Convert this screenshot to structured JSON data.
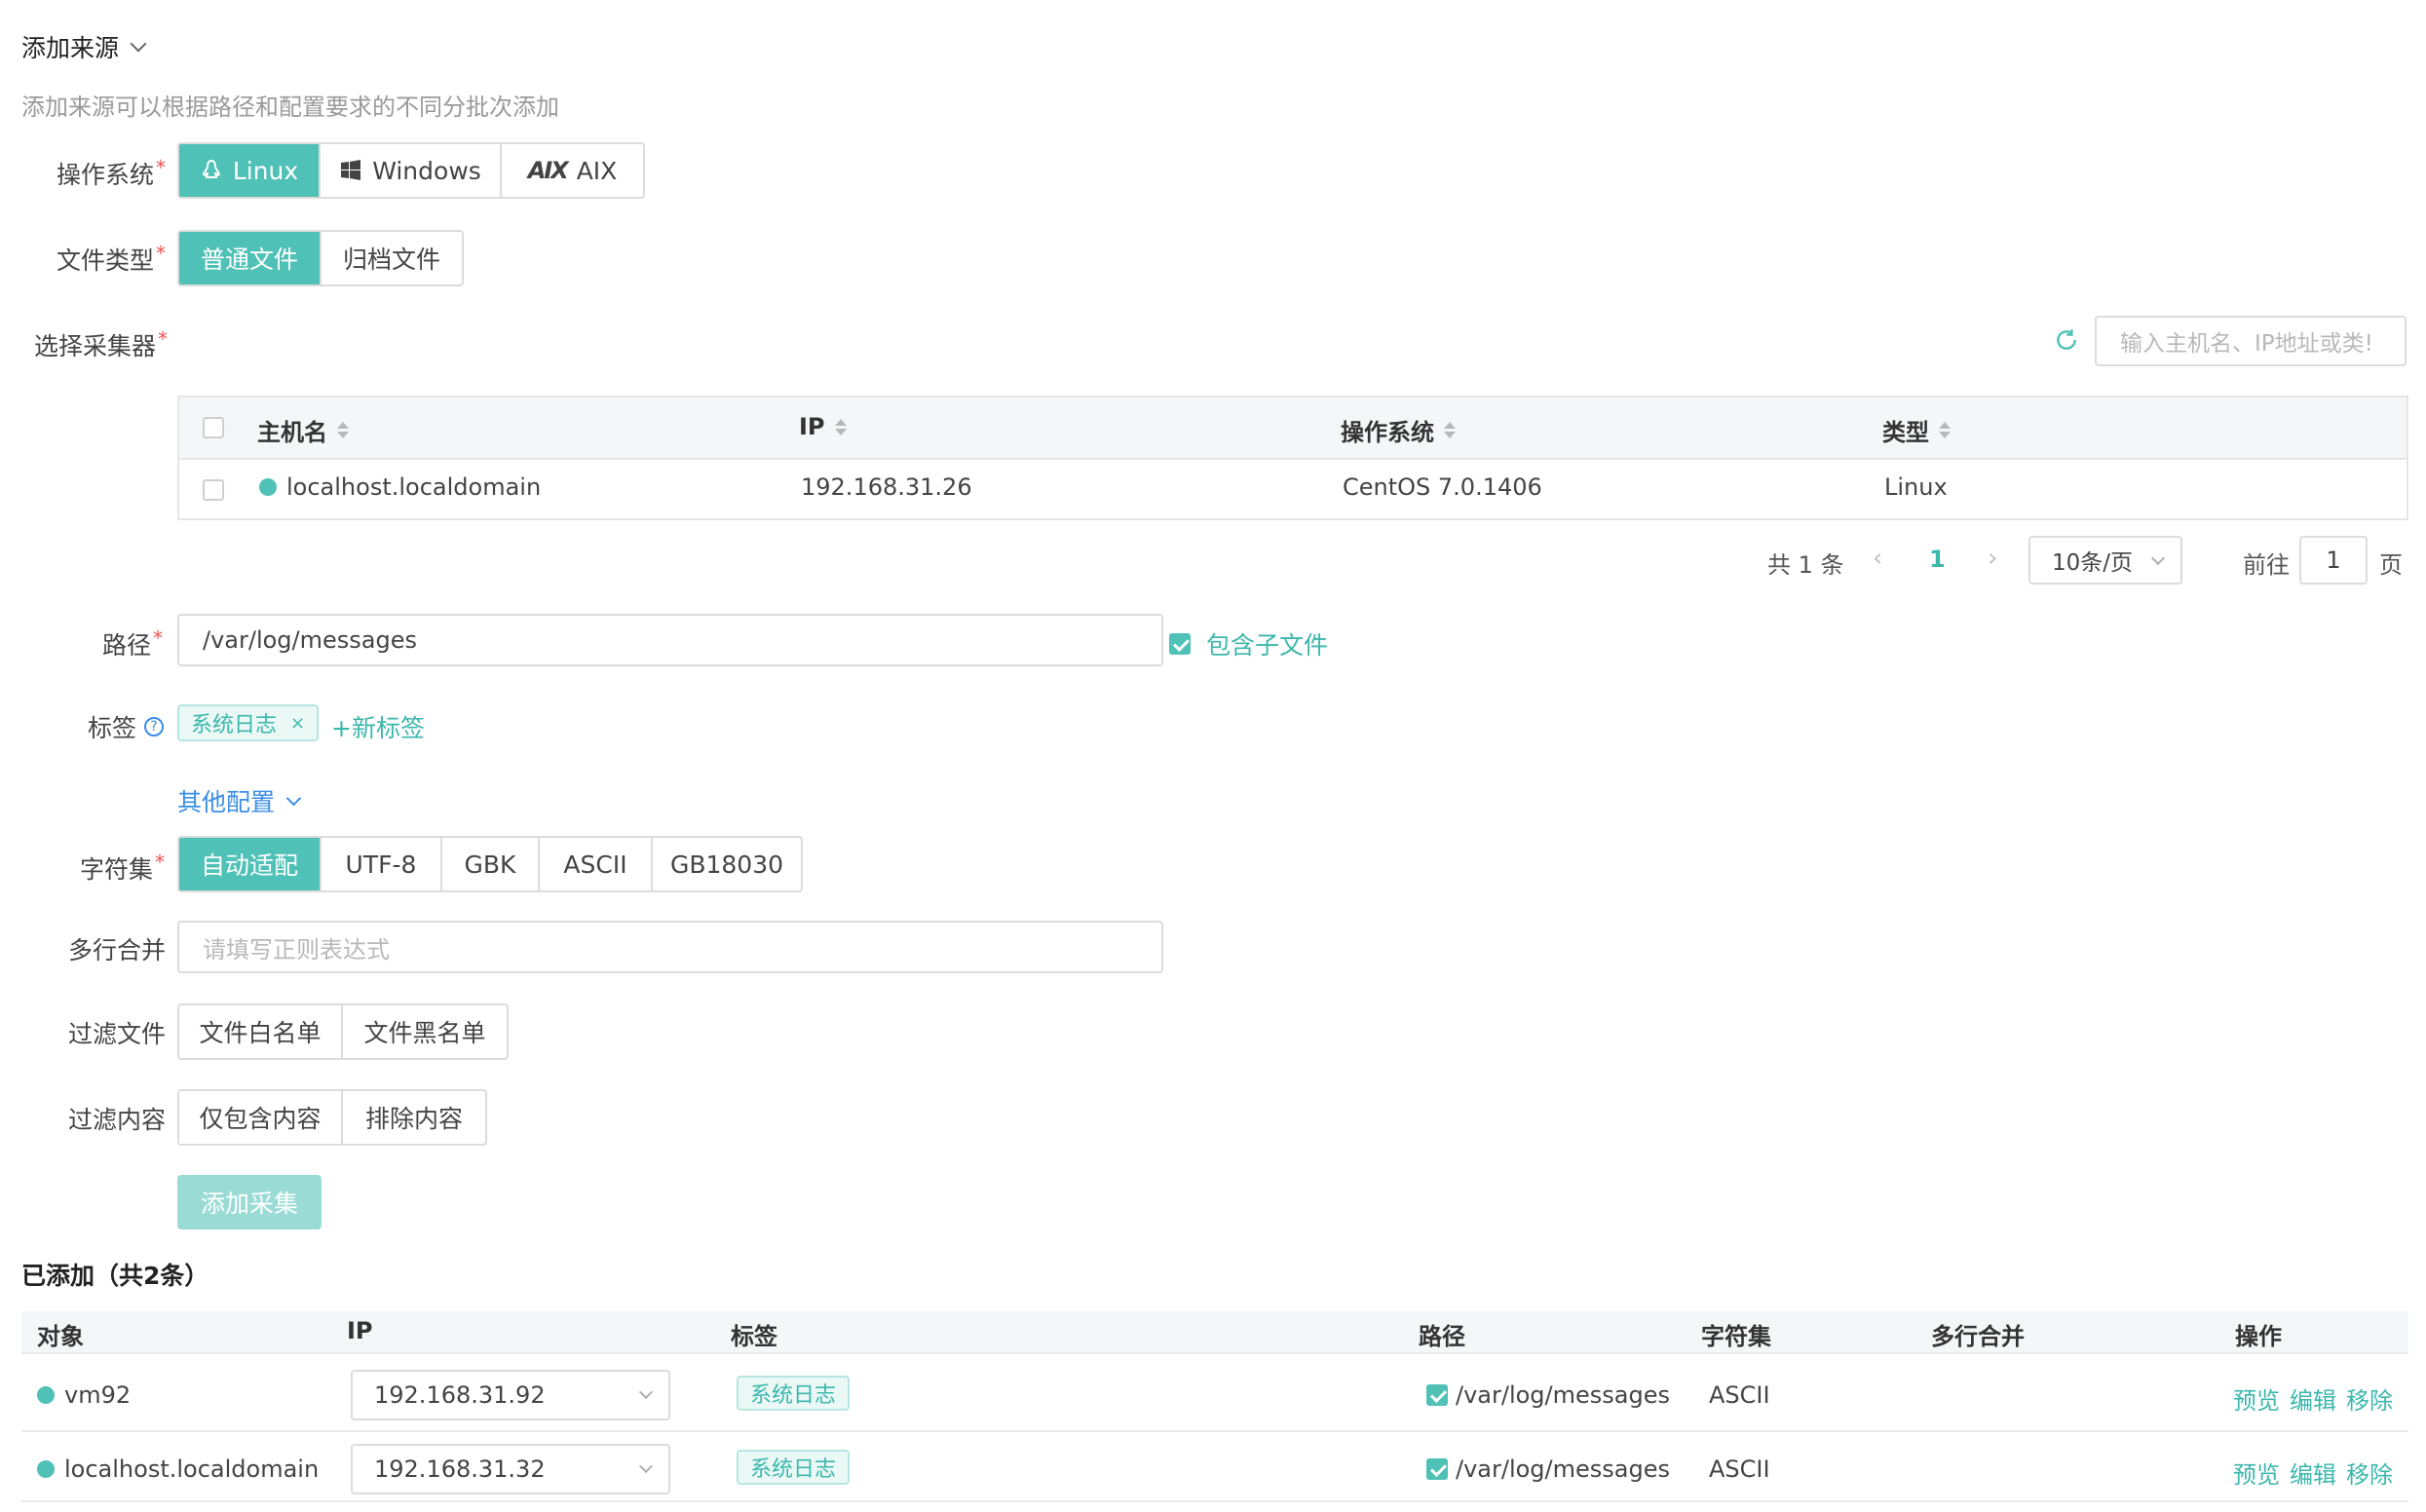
{
  "header": {
    "title": "添加来源",
    "hint": "添加来源可以根据路径和配置要求的不同分批次添加"
  },
  "form": {
    "os_label": "操作系统",
    "os_options": [
      "Linux",
      "Windows",
      "AIX"
    ],
    "os_selected": "Linux",
    "filetype_label": "文件类型",
    "filetype_options": [
      "普通文件",
      "归档文件"
    ],
    "filetype_selected": "普通文件",
    "collector_label": "选择采集器",
    "collector_search_placeholder": "输入主机名、IP地址或类!",
    "path_label": "路径",
    "path_value": "/var/log/messages",
    "include_subfiles_label": "包含子文件",
    "include_subfiles_checked": true,
    "tags_label": "标签",
    "tags": [
      "系统日志"
    ],
    "new_tag_label": "+新标签",
    "other_config_label": "其他配置",
    "charset_label": "字符集",
    "charset_options": [
      "自动适配",
      "UTF-8",
      "GBK",
      "ASCII",
      "GB18030"
    ],
    "charset_selected": "自动适配",
    "multiline_label": "多行合并",
    "multiline_placeholder": "请填写正则表达式",
    "filter_file_label": "过滤文件",
    "filter_file_options": [
      "文件白名单",
      "文件黑名单"
    ],
    "filter_content_label": "过滤内容",
    "filter_content_options": [
      "仅包含内容",
      "排除内容"
    ],
    "submit_label": "添加采集"
  },
  "collector_table": {
    "columns": [
      "主机名",
      "IP",
      "操作系统",
      "类型"
    ],
    "rows": [
      {
        "hostname": "localhost.localdomain",
        "ip": "192.168.31.26",
        "os": "CentOS 7.0.1406",
        "type": "Linux",
        "status_color": "#4fc1b6"
      }
    ]
  },
  "pagination": {
    "total_text": "共 1 条",
    "current_page": "1",
    "page_size": "10条/页",
    "goto_label": "前往",
    "goto_value": "1",
    "page_suffix": "页"
  },
  "added": {
    "title": "已添加（共2条）",
    "columns": [
      "对象",
      "IP",
      "标签",
      "路径",
      "字符集",
      "多行合并",
      "操作"
    ],
    "rows": [
      {
        "object": "vm92",
        "ip": "192.168.31.92",
        "tag": "系统日志",
        "path": "/var/log/messages",
        "charset": "ASCII",
        "multiline": "",
        "actions": [
          "预览",
          "编辑",
          "移除"
        ]
      },
      {
        "object": "localhost.localdomain",
        "ip": "192.168.31.32",
        "tag": "系统日志",
        "path": "/var/log/messages",
        "charset": "ASCII",
        "multiline": "",
        "actions": [
          "预览",
          "编辑",
          "移除"
        ]
      }
    ]
  },
  "colors": {
    "accent": "#4fc1b6",
    "link_blue": "#3a8ee6",
    "required": "#f04f4f"
  }
}
